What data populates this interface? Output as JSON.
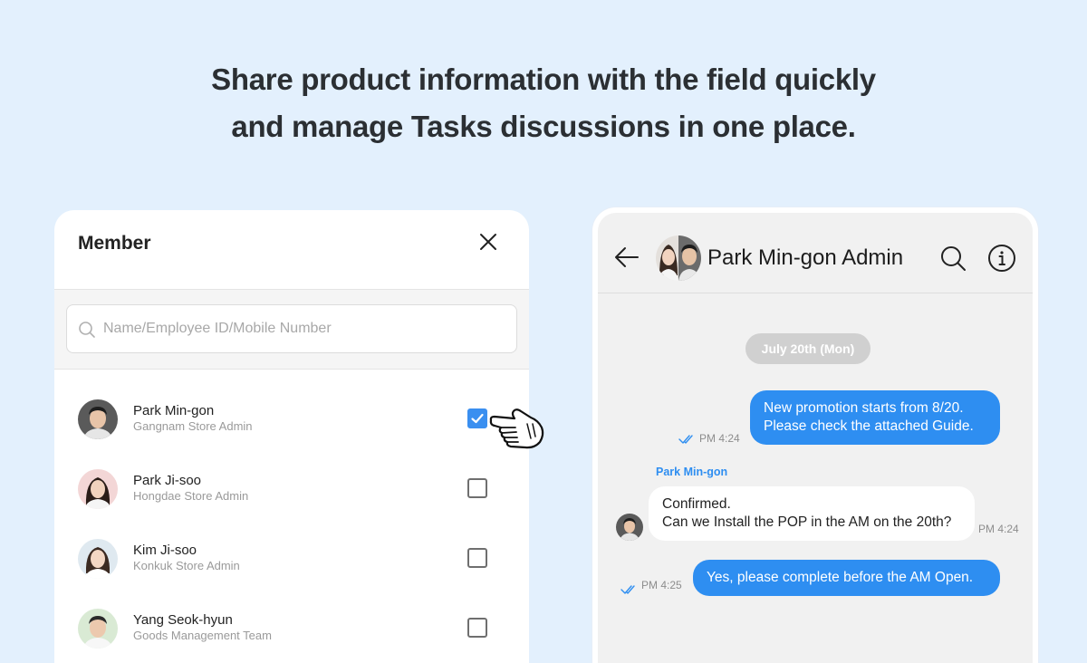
{
  "headline": {
    "line1": "Share product information with the field quickly",
    "line2": "and manage Tasks discussions in one place."
  },
  "member_panel": {
    "title": "Member",
    "search_placeholder": "Name/Employee ID/Mobile Number",
    "members": [
      {
        "name": "Park Min-gon",
        "role": "Gangnam Store Admin",
        "checked": true
      },
      {
        "name": "Park Ji-soo",
        "role": "Hongdae Store Admin",
        "checked": false
      },
      {
        "name": "Kim Ji-soo",
        "role": "Konkuk Store Admin",
        "checked": false
      },
      {
        "name": "Yang Seok-hyun",
        "role": "Goods Management Team",
        "checked": false
      }
    ]
  },
  "chat": {
    "title": "Park Min-gon Admin",
    "date": "July 20th (Mon)",
    "messages": [
      {
        "direction": "out",
        "lines": [
          "New promotion starts from 8/20.",
          "Please check the attached Guide."
        ],
        "time": "PM 4:24"
      },
      {
        "direction": "in",
        "sender": "Park Min-gon",
        "lines": [
          "Confirmed.",
          "Can we Install the POP in the AM on the 20th?"
        ],
        "time": "PM 4:24"
      },
      {
        "direction": "out",
        "lines": [
          "Yes, please complete before the AM Open."
        ],
        "time": "PM 4:25"
      }
    ]
  },
  "colors": {
    "background": "#e3f0fd",
    "accent": "#2e8ef1",
    "checkbox_checked": "#3a8ff0",
    "date_chip": "#d0d0d0"
  },
  "icons": [
    "close-icon",
    "search-icon",
    "back-arrow-icon",
    "info-icon",
    "read-check-icon",
    "pointing-hand-icon",
    "check-icon"
  ]
}
